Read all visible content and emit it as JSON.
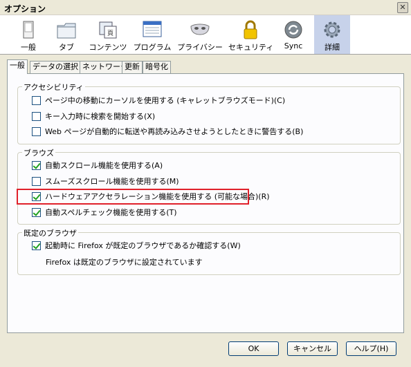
{
  "window": {
    "title": "オプション",
    "close_glyph": "✕"
  },
  "toolbar": {
    "items": [
      {
        "label": "一般",
        "icon": "general-icon"
      },
      {
        "label": "タブ",
        "icon": "tabs-icon"
      },
      {
        "label": "コンテンツ",
        "icon": "content-icon"
      },
      {
        "label": "プログラム",
        "icon": "applications-icon"
      },
      {
        "label": "プライバシー",
        "icon": "privacy-mask-icon"
      },
      {
        "label": "セキュリティ",
        "icon": "security-lock-icon"
      },
      {
        "label": "Sync",
        "icon": "sync-icon"
      },
      {
        "label": "詳細",
        "icon": "advanced-gear-icon",
        "selected": true
      }
    ]
  },
  "tabs": [
    "一般",
    "データの選択",
    "ネットワーク",
    "更新",
    "暗号化"
  ],
  "groups": {
    "accessibility": {
      "title": "アクセシビリティ",
      "options": [
        {
          "label": "ページ中の移動にカーソルを使用する (キャレットブラウズモード)(C)",
          "checked": false
        },
        {
          "label": "キー入力時に検索を開始する(X)",
          "checked": false
        },
        {
          "label": "Web ページが自動的に転送や再読み込みさせようとしたときに警告する(B)",
          "checked": false
        }
      ]
    },
    "browsing": {
      "title": "ブラウズ",
      "options": [
        {
          "label": "自動スクロール機能を使用する(A)",
          "checked": true
        },
        {
          "label": "スムーズスクロール機能を使用する(M)",
          "checked": false
        },
        {
          "label": "ハードウェアアクセラレーション機能を使用する (可能な場合)(R)",
          "checked": true
        },
        {
          "label": "自動スペルチェック機能を使用する(T)",
          "checked": true
        }
      ]
    },
    "default_browser": {
      "title": "既定のブラウザ",
      "options": [
        {
          "label": "起動時に Firefox が既定のブラウザであるか確認する(W)",
          "checked": true
        }
      ],
      "status": "Firefox は既定のブラウザに設定されています"
    }
  },
  "buttons": {
    "ok": "OK",
    "cancel": "キャンセル",
    "help": "ヘルプ(H)"
  },
  "colors": {
    "highlight": "#e0202a",
    "selected_tool": "#c7d2ea"
  }
}
